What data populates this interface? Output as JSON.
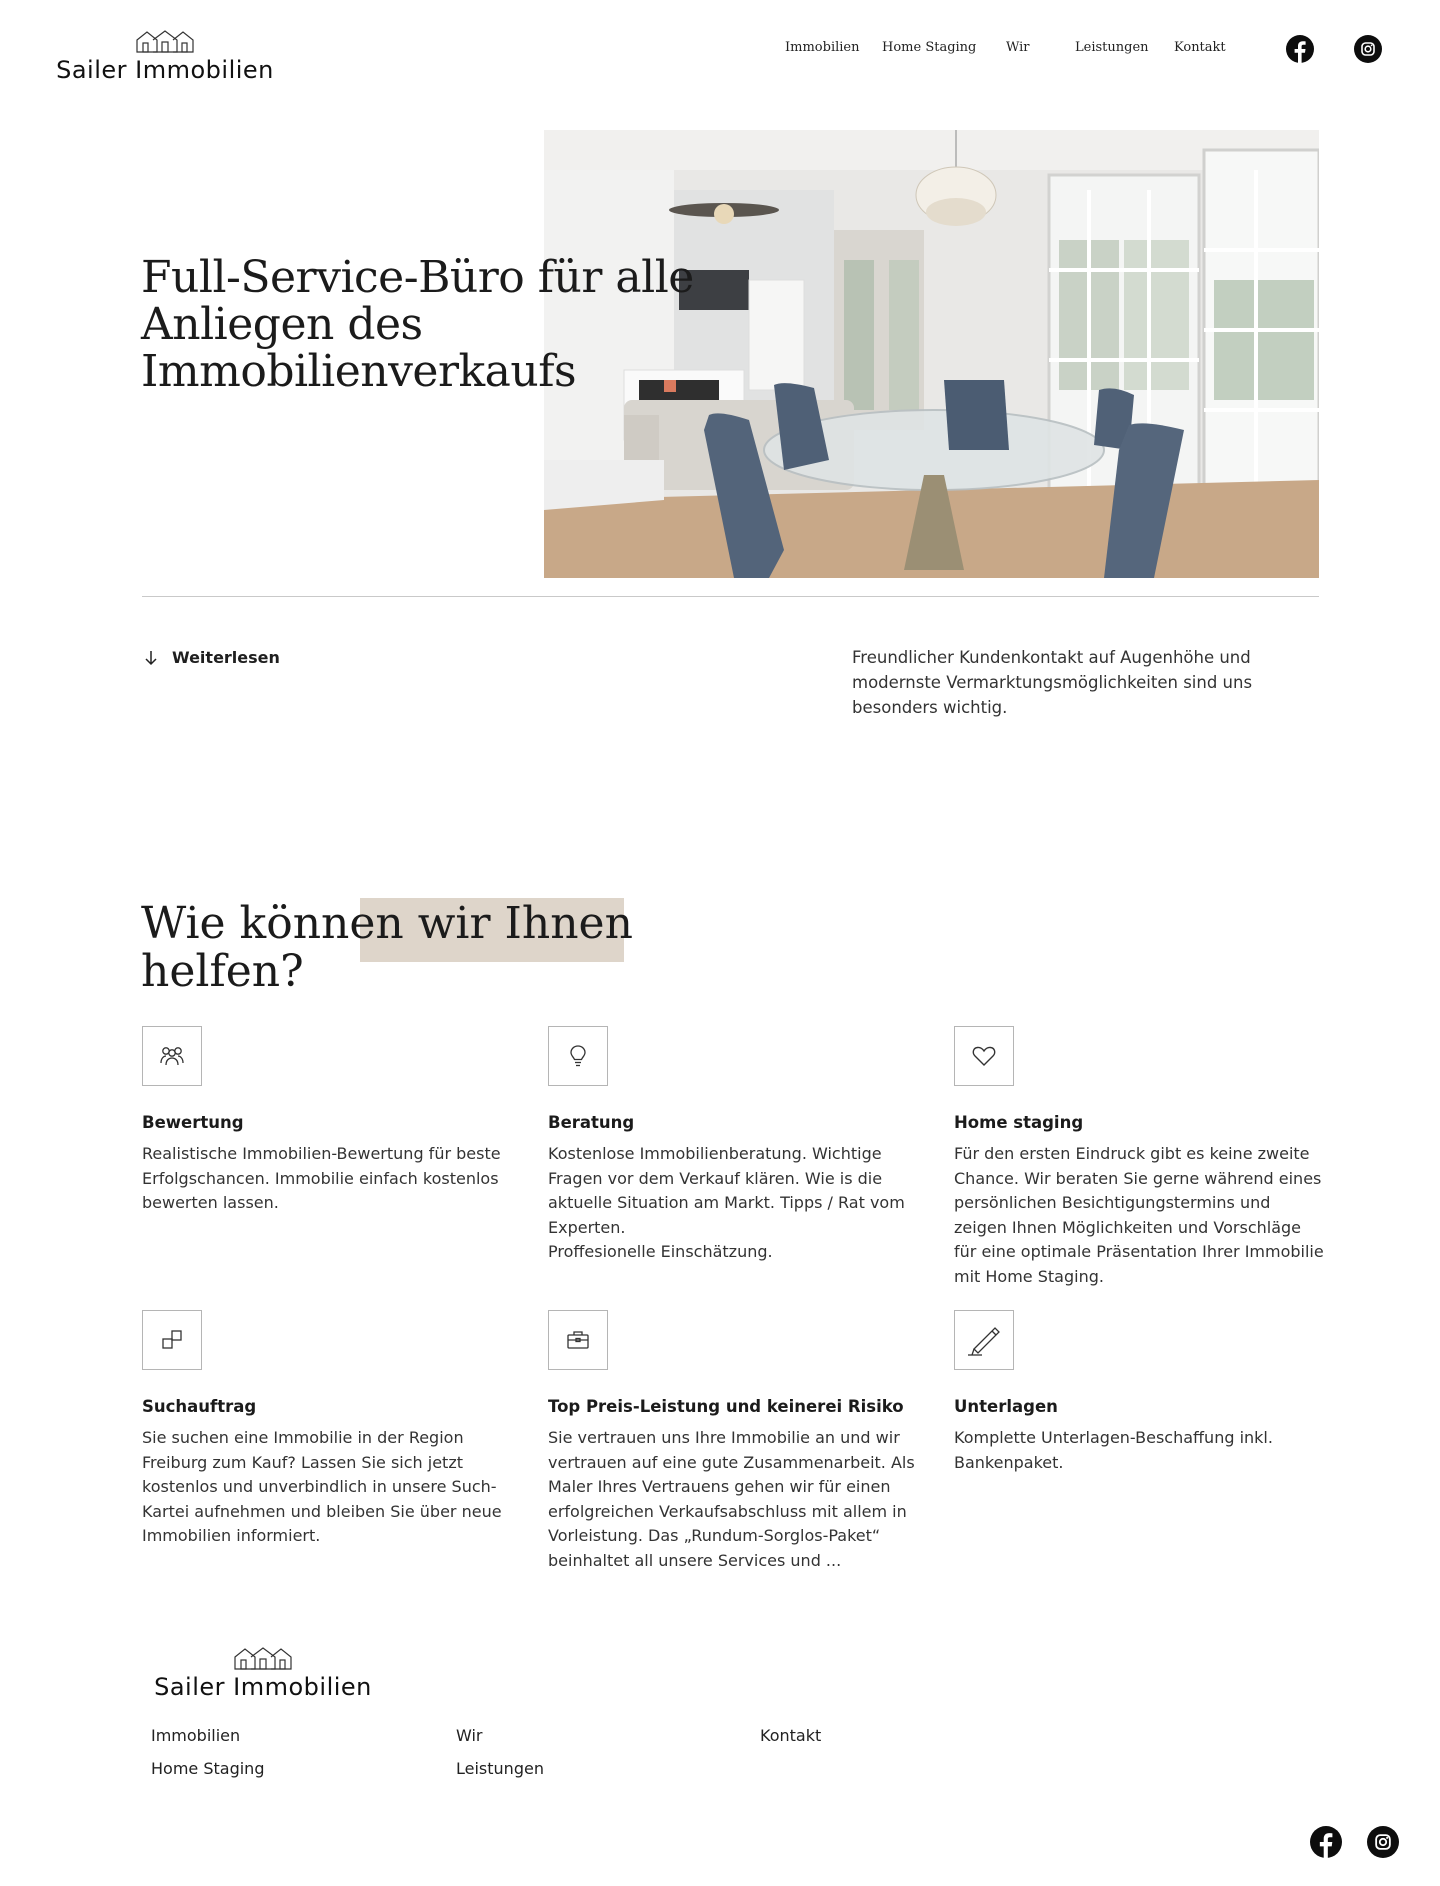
{
  "header": {
    "brand": "Sailer Immobilien",
    "nav": {
      "immobilien": "Immobilien",
      "home_staging": "Home Staging",
      "wir": "Wir",
      "leistungen": "Leistungen",
      "kontakt": "Kontakt"
    },
    "social": {
      "facebook_icon": "facebook-icon",
      "instagram_icon": "instagram-icon"
    }
  },
  "hero": {
    "title": "Full-Service-Büro für alle Anliegen des Immobilienverkaufs",
    "read_more": "Weiterlesen",
    "intro": "Freundlicher Kundenkontakt auf Augenhöhe und modernste Vermarktungsmöglichkeiten sind uns besonders wichtig."
  },
  "services": {
    "title": "Wie können wir Ihnen helfen?",
    "items": [
      {
        "icon": "people-icon",
        "title": "Bewertung",
        "text": "Realistische Immobilien-Bewertung für beste Erfolgschancen. Immobilie einfach kostenlos bewerten lassen."
      },
      {
        "icon": "lightbulb-icon",
        "title": "Beratung",
        "text": "Kostenlose Immobilienberatung. Wichtige Fragen vor dem Verkauf klären. Wie is die aktuelle Situation am Markt. Tipps / Rat vom Experten.\nProffesionelle Einschätzung."
      },
      {
        "icon": "heart-icon",
        "title": "Home staging",
        "text": "Für den ersten Eindruck gibt es keine zweite Chance. Wir beraten Sie gerne während eines persönlichen Besichtigungstermins und zeigen Ihnen Möglichkeiten und Vorschläge für eine optimale Präsentation Ihrer Immobilie mit Home Staging."
      },
      {
        "icon": "squares-icon",
        "title": "Suchauftrag",
        "text": "Sie suchen eine Immobilie in der Region Freiburg zum Kauf? Lassen Sie sich jetzt kostenlos und unverbindlich in unsere Such-Kartei aufnehmen und bleiben Sie über neue Immobilien informiert."
      },
      {
        "icon": "briefcase-icon",
        "title": "Top Preis-Leistung und keinerei Risiko",
        "text": "Sie vertrauen uns Ihre Immobilie an und wir vertrauen auf eine gute Zusammenarbeit. Als Maler Ihres Vertrauens gehen wir für einen erfolgreichen Verkaufsabschluss mit allem in Vorleistung. Das „Rundum-Sorglos-Paket“ beinhaltet all unsere Services und ..."
      },
      {
        "icon": "pen-icon",
        "title": "Unterlagen",
        "text": "Komplette Unterlagen-Beschaffung inkl. Bankenpaket."
      }
    ]
  },
  "footer": {
    "brand": "Sailer Immobilien",
    "links": {
      "immobilien": "Immobilien",
      "home_staging": "Home Staging",
      "wir": "Wir",
      "leistungen": "Leistungen",
      "kontakt": "Kontakt"
    }
  },
  "colors": {
    "accent_highlight": "#ded5ca",
    "text": "#1f1f1f",
    "divider": "#c9c9c9"
  }
}
